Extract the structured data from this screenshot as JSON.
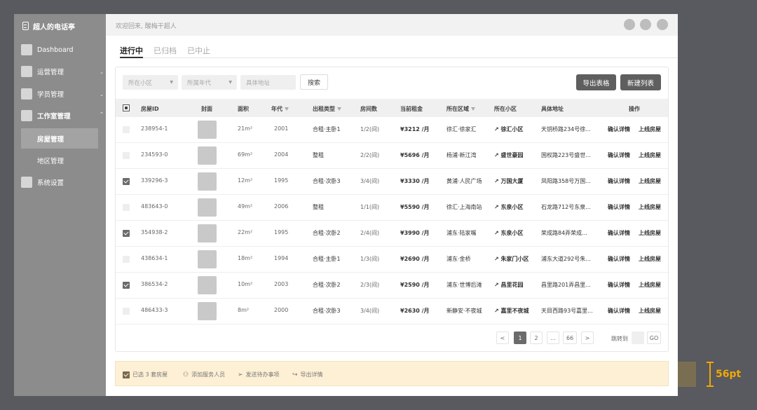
{
  "sidebar": {
    "title": "超人的电话亭",
    "items": [
      {
        "label": "Dashboard"
      },
      {
        "label": "运营管理",
        "chevron": "chevron-down-icon"
      },
      {
        "label": "学员管理",
        "chevron": "chevron-down-icon"
      },
      {
        "label": "工作室管理",
        "chevron": "chevron-up-icon"
      },
      {
        "label": "系统设置"
      }
    ],
    "subitems": [
      {
        "label": "房屋管理",
        "active": true
      },
      {
        "label": "地区管理",
        "active": false
      }
    ]
  },
  "topbar": {
    "welcome": "欢迎回来, 酸梅干超人"
  },
  "tabs": [
    {
      "label": "进行中",
      "active": true
    },
    {
      "label": "已归档",
      "active": false
    },
    {
      "label": "已中止",
      "active": false
    }
  ],
  "filters": {
    "district": "所在小区",
    "year": "所属年代",
    "address": "具体地址",
    "search": "搜索",
    "export": "导出表格",
    "create": "新建列表"
  },
  "table": {
    "headers": [
      "房屋ID",
      "封面",
      "面积",
      "年代",
      "出租类型",
      "房间数",
      "当前租金",
      "所在区域",
      "所在小区",
      "具体地址",
      "操作"
    ],
    "rows": [
      {
        "checked": false,
        "id": "238954-1",
        "area": "21m²",
        "year": "2001",
        "type": "合租·主卧1",
        "rooms": "1/2(间)",
        "rent": "¥3212 /月",
        "region": "徐汇·徐家汇",
        "community": "↗ 徐汇小区",
        "address": "天钥桥路234号徐...",
        "op1": "确认详情",
        "op2": "上线房屋"
      },
      {
        "checked": false,
        "id": "234593-0",
        "area": "69m²",
        "year": "2004",
        "type": "整租",
        "rooms": "2/2(间)",
        "rent": "¥5696 /月",
        "region": "杨浦·新江湾",
        "community": "↗ 盛世豪园",
        "address": "国权路223号盛世...",
        "op1": "确认详情",
        "op2": "上线房屋"
      },
      {
        "checked": true,
        "id": "339296-3",
        "area": "12m²",
        "year": "1995",
        "type": "合租·次卧3",
        "rooms": "3/4(间)",
        "rent": "¥3330 /月",
        "region": "黄浦·人民广场",
        "community": "↗ 万国大厦",
        "address": "凤阳路358号万国...",
        "op1": "确认详情",
        "op2": "上线房屋"
      },
      {
        "checked": false,
        "id": "483643-0",
        "area": "49m²",
        "year": "2006",
        "type": "整租",
        "rooms": "1/1(间)",
        "rent": "¥5590 /月",
        "region": "徐汇·上海南站",
        "community": "↗ 东泉小区",
        "address": "石龙路712号东泉...",
        "op1": "确认详情",
        "op2": "上线房屋"
      },
      {
        "checked": true,
        "id": "354938-2",
        "area": "22m²",
        "year": "1995",
        "type": "合租·次卧2",
        "rooms": "2/4(间)",
        "rent": "¥3990 /月",
        "region": "浦东·陆家嘴",
        "community": "↗ 东泉小区",
        "address": "荣成路84弄荣成...",
        "op1": "确认详情",
        "op2": "上线房屋"
      },
      {
        "checked": false,
        "id": "438634-1",
        "area": "18m²",
        "year": "1994",
        "type": "合租·主卧1",
        "rooms": "1/3(间)",
        "rent": "¥2690 /月",
        "region": "浦东·金桥",
        "community": "↗ 朱家门小区",
        "address": "浦东大道292号朱...",
        "op1": "确认详情",
        "op2": "上线房屋"
      },
      {
        "checked": true,
        "id": "386534-2",
        "area": "10m²",
        "year": "2003",
        "type": "合租·次卧2",
        "rooms": "2/3(间)",
        "rent": "¥2590 /月",
        "region": "浦东·世博后滩",
        "community": "↗ 昌里花园",
        "address": "昌里路201弄昌里...",
        "op1": "确认详情",
        "op2": "上线房屋"
      },
      {
        "checked": false,
        "id": "486433-3",
        "area": "8m²",
        "year": "2000",
        "type": "合租·次卧3",
        "rooms": "3/4(间)",
        "rent": "¥2630 /月",
        "region": "新静安·不夜城",
        "community": "↗ 嘉里不夜城",
        "address": "天目西路93号嘉里...",
        "op1": "确认详情",
        "op2": "上线房屋"
      }
    ]
  },
  "pagination": {
    "prev": "<",
    "pages": [
      "1",
      "2",
      "...",
      "66"
    ],
    "next": ">",
    "jump_label": "跳转到",
    "go": "GO"
  },
  "bottombar": {
    "selected": "已选 3 套房屋",
    "add_staff": "添加服务人员",
    "send_todo": "发送待办事项",
    "export_detail": "导出详情"
  },
  "annotation": {
    "label": "56pt"
  }
}
